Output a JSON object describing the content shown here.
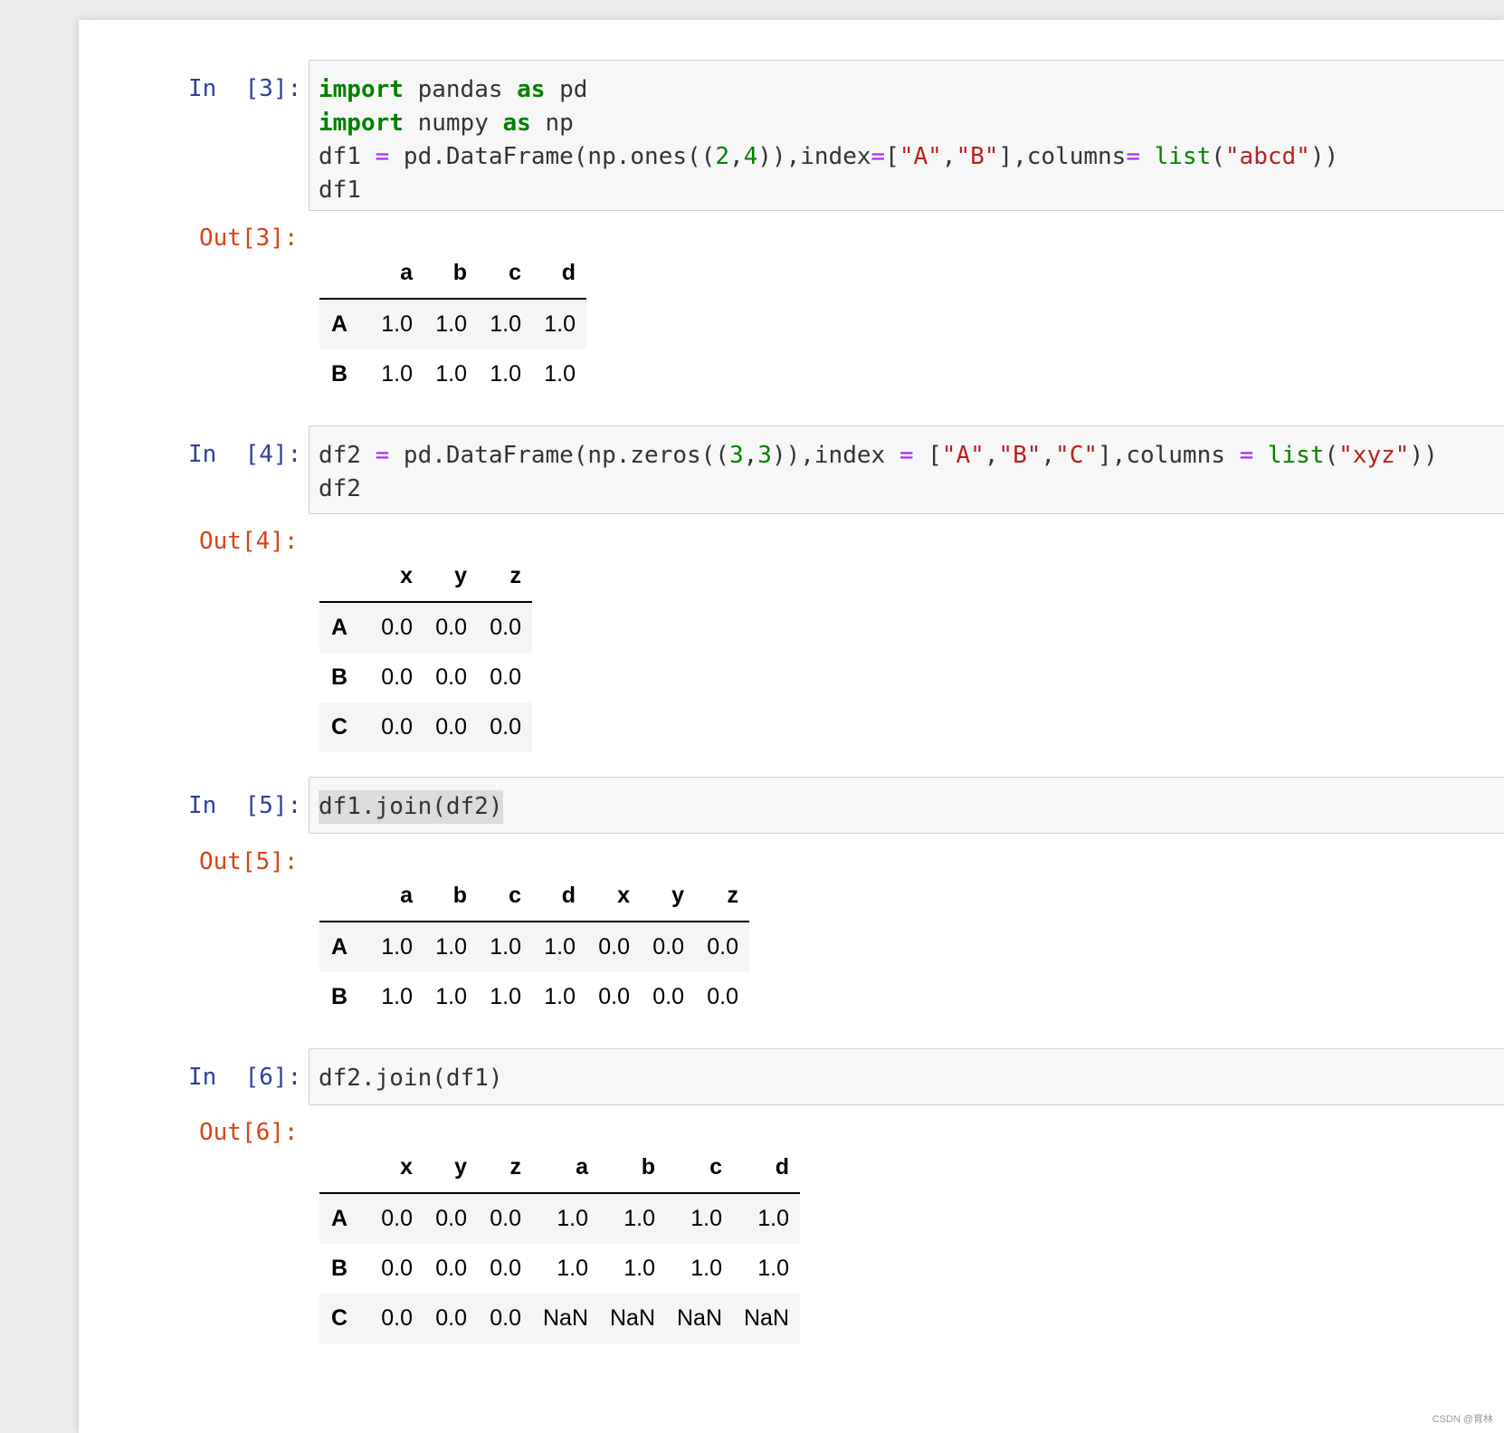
{
  "cells": [
    {
      "in_prompt": "In  [3]:",
      "out_prompt": "Out[3]:",
      "code_lines": [
        "import pandas as pd",
        "import numpy as np",
        "df1 = pd.DataFrame(np.ones((2,4)),index=[\"A\",\"B\"],columns= list(\"abcd\"))",
        "df1"
      ],
      "table": {
        "columns": [
          "a",
          "b",
          "c",
          "d"
        ],
        "rows": [
          {
            "index": "A",
            "values": [
              "1.0",
              "1.0",
              "1.0",
              "1.0"
            ]
          },
          {
            "index": "B",
            "values": [
              "1.0",
              "1.0",
              "1.0",
              "1.0"
            ]
          }
        ]
      }
    },
    {
      "in_prompt": "In  [4]:",
      "out_prompt": "Out[4]:",
      "code_lines": [
        "df2 = pd.DataFrame(np.zeros((3,3)),index = [\"A\",\"B\",\"C\"],columns = list(\"xyz\"))",
        "df2"
      ],
      "table": {
        "columns": [
          "x",
          "y",
          "z"
        ],
        "rows": [
          {
            "index": "A",
            "values": [
              "0.0",
              "0.0",
              "0.0"
            ]
          },
          {
            "index": "B",
            "values": [
              "0.0",
              "0.0",
              "0.0"
            ]
          },
          {
            "index": "C",
            "values": [
              "0.0",
              "0.0",
              "0.0"
            ]
          }
        ]
      }
    },
    {
      "in_prompt": "In  [5]:",
      "out_prompt": "Out[5]:",
      "code_lines": [
        "df1.join(df2)"
      ],
      "table": {
        "columns": [
          "a",
          "b",
          "c",
          "d",
          "x",
          "y",
          "z"
        ],
        "rows": [
          {
            "index": "A",
            "values": [
              "1.0",
              "1.0",
              "1.0",
              "1.0",
              "0.0",
              "0.0",
              "0.0"
            ]
          },
          {
            "index": "B",
            "values": [
              "1.0",
              "1.0",
              "1.0",
              "1.0",
              "0.0",
              "0.0",
              "0.0"
            ]
          }
        ]
      }
    },
    {
      "in_prompt": "In  [6]:",
      "out_prompt": "Out[6]:",
      "code_lines": [
        "df2.join(df1)"
      ],
      "table": {
        "columns": [
          "x",
          "y",
          "z",
          "a",
          "b",
          "c",
          "d"
        ],
        "rows": [
          {
            "index": "A",
            "values": [
              "0.0",
              "0.0",
              "0.0",
              "1.0",
              "1.0",
              "1.0",
              "1.0"
            ]
          },
          {
            "index": "B",
            "values": [
              "0.0",
              "0.0",
              "0.0",
              "1.0",
              "1.0",
              "1.0",
              "1.0"
            ]
          },
          {
            "index": "C",
            "values": [
              "0.0",
              "0.0",
              "0.0",
              "NaN",
              "NaN",
              "NaN",
              "NaN"
            ]
          }
        ]
      }
    }
  ],
  "watermark": "CSDN @育林",
  "colors": {
    "in_prompt": "#303f9f",
    "out_prompt": "#d84315",
    "keyword": "#008000",
    "string": "#ba2121",
    "operator": "#aa22ff",
    "code_bg": "#f7f7f7"
  }
}
